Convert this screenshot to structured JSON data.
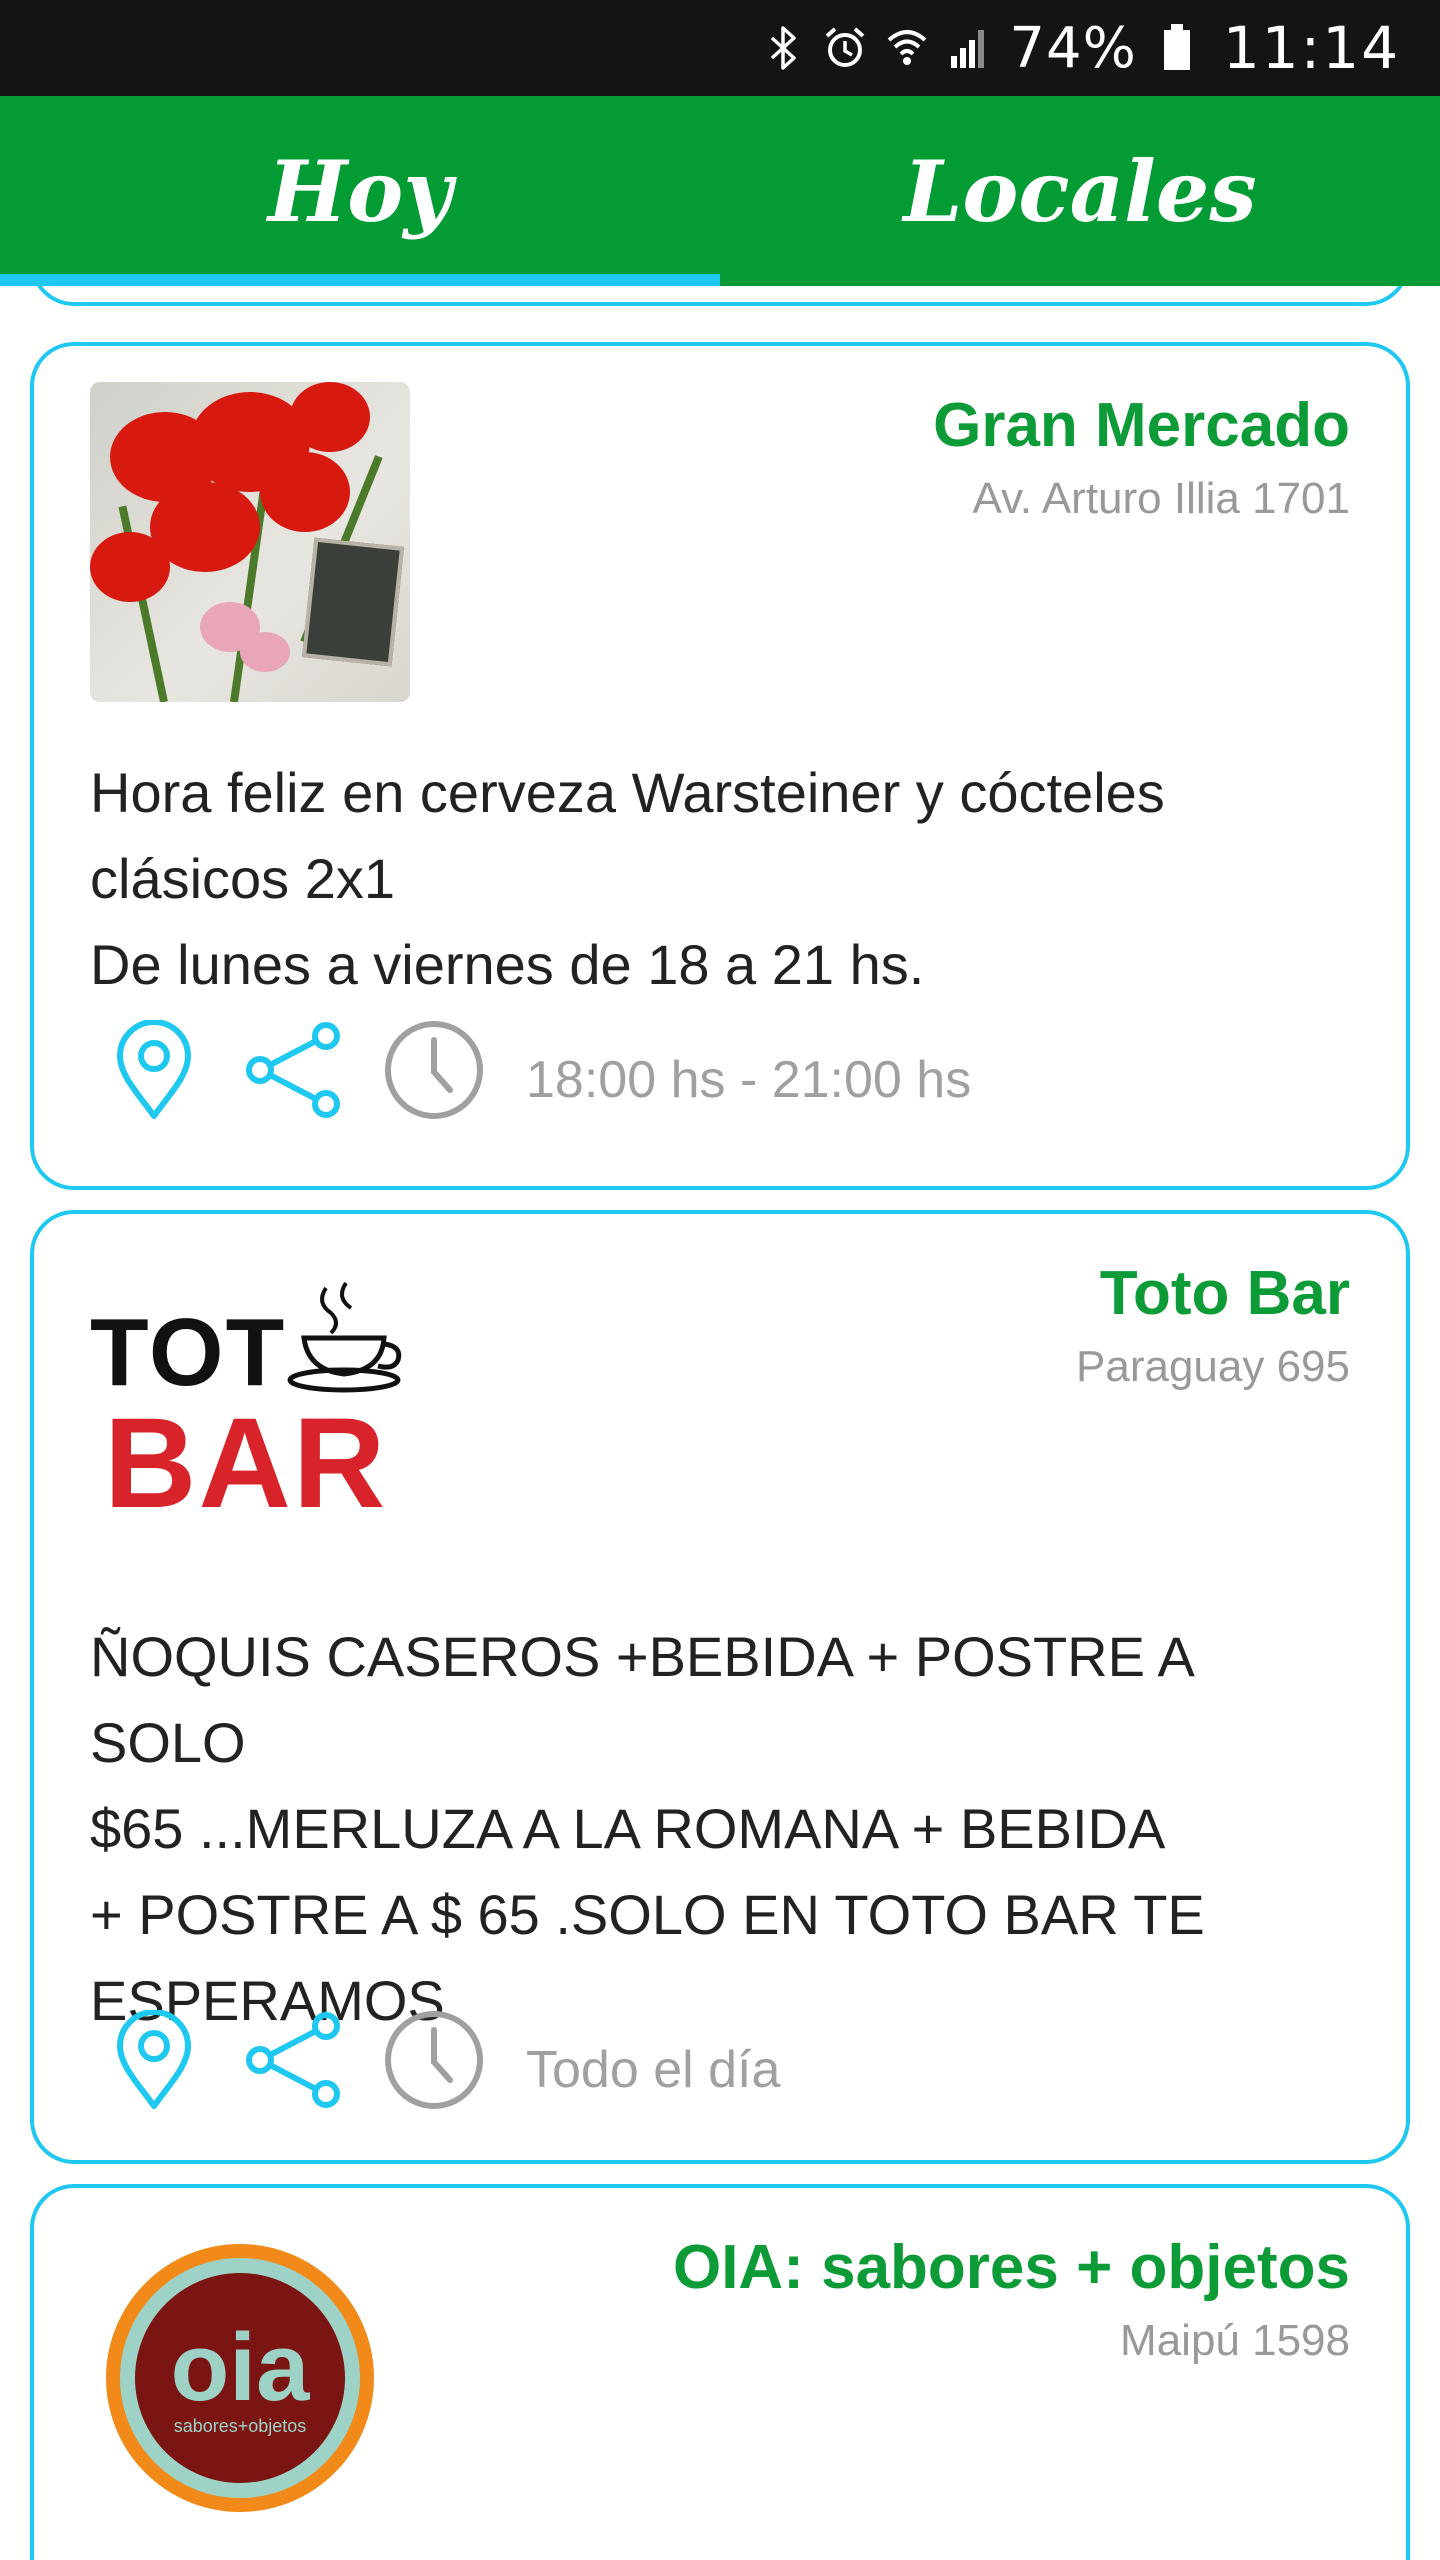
{
  "status_bar": {
    "battery_percent": "74%",
    "time": "11:14",
    "icons": [
      "bluetooth-icon",
      "alarm-icon",
      "wifi-icon",
      "signal-icon",
      "battery-icon"
    ]
  },
  "tabs": [
    {
      "label": "Hoy",
      "selected": true
    },
    {
      "label": "Locales",
      "selected": false
    }
  ],
  "colors": {
    "primary_green": "#039b34",
    "accent_cyan": "#1ec8f0",
    "name_green": "#0d9b38",
    "muted_gray": "#999999"
  },
  "cards": [
    {
      "name": "Gran Mercado",
      "address": "Av. Arturo Illia 1701",
      "text": "Hora feliz en cerveza Warsteiner y cócteles\nclásicos 2x1\nDe lunes a viernes de 18 a 21 hs.",
      "time": "18:00 hs - 21:00 hs"
    },
    {
      "name": "Toto Bar",
      "address": "Paraguay 695",
      "logo_top": "TOT",
      "logo_bottom": "BAR",
      "text": "ÑOQUIS CASEROS +BEBIDA + POSTRE A SOLO\n$65 ...MERLUZA A LA ROMANA  + BEBIDA\n+ POSTRE A $ 65 .SOLO EN TOTO BAR TE\nESPERAMOS",
      "time": "Todo el día"
    },
    {
      "name": "OIA: sabores + objetos",
      "address": "Maipú 1598",
      "logo": "oia",
      "logo_sub": "sabores+objetos"
    }
  ]
}
